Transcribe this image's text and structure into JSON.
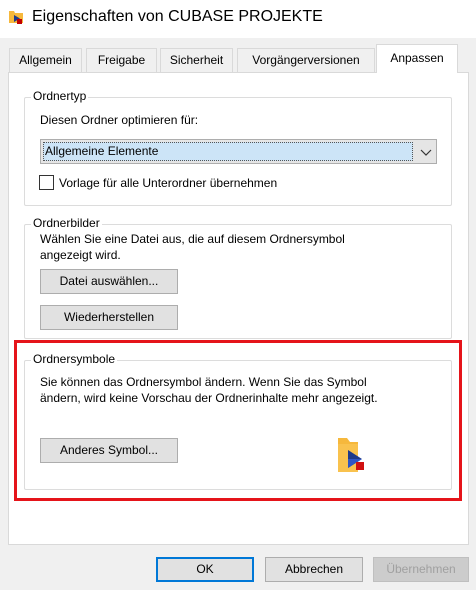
{
  "window": {
    "title": "Eigenschaften von CUBASE PROJEKTE",
    "title_icon": "folder-cubase-icon"
  },
  "tabs": [
    {
      "label": "Allgemein",
      "active": false
    },
    {
      "label": "Freigabe",
      "active": false
    },
    {
      "label": "Sicherheit",
      "active": false
    },
    {
      "label": "Vorgängerversionen",
      "active": false
    },
    {
      "label": "Anpassen",
      "active": true
    }
  ],
  "ordnertyp": {
    "group_label": "Ordnertyp",
    "optimize_label": "Diesen Ordner optimieren für:",
    "optimize_value": "Allgemeine Elemente",
    "template_checkbox_label": "Vorlage für alle Unterordner übernehmen",
    "template_checked": false
  },
  "ordnerbilder": {
    "group_label": "Ordnerbilder",
    "description_line1": "Wählen Sie eine Datei aus, die auf diesem Ordnersymbol",
    "description_line2": "angezeigt wird.",
    "choose_file_button": "Datei auswählen...",
    "restore_button": "Wiederherstellen"
  },
  "ordnersymbole": {
    "group_label": "Ordnersymbole",
    "description_line1": "Sie können das Ordnersymbol ändern. Wenn Sie das Symbol",
    "description_line2": "ändern, wird keine Vorschau der Ordnerinhalte mehr angezeigt.",
    "change_icon_button": "Anderes Symbol...",
    "preview_icon": "folder-cubase-icon"
  },
  "footer": {
    "ok_label": "OK",
    "cancel_label": "Abbrechen",
    "apply_label": "Übernehmen"
  },
  "colors": {
    "highlight_border": "#e5141a",
    "accent": "#0078d7",
    "folder": "#f6b83c"
  }
}
